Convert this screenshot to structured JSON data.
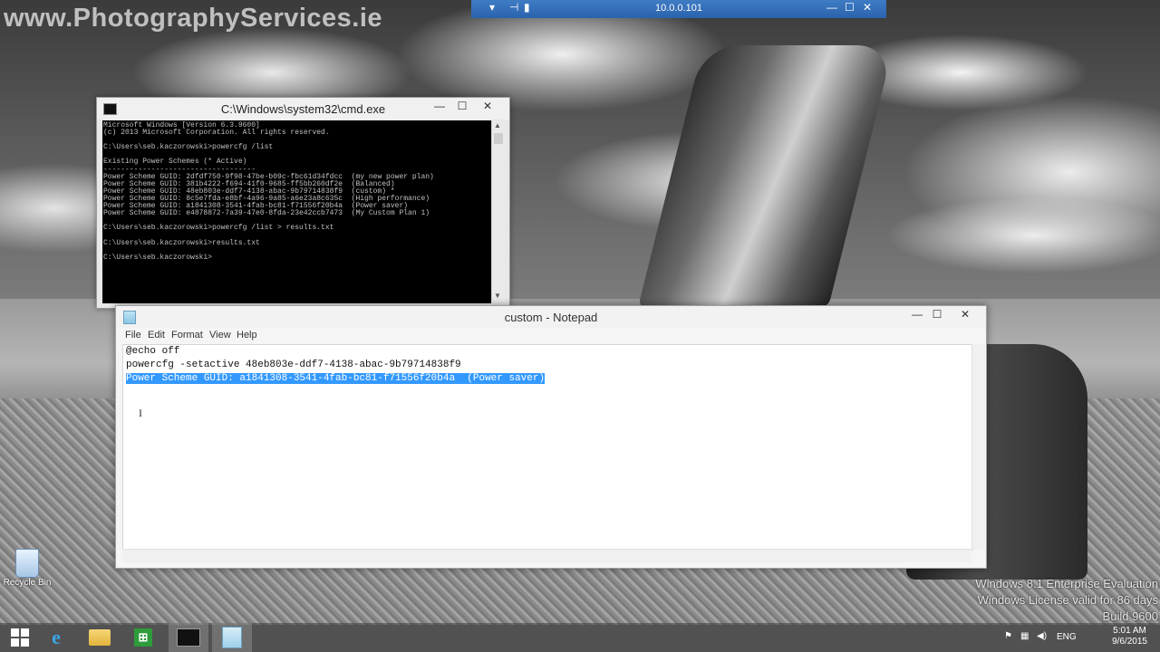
{
  "watermark": "www.PhotographyServices.ie",
  "remote_bar": {
    "host": "10.0.0.101"
  },
  "cmd": {
    "title": "C:\\Windows\\system32\\cmd.exe",
    "lines": [
      "Microsoft Windows [Version 6.3.9600]",
      "(c) 2013 Microsoft Corporation. All rights reserved.",
      "",
      "C:\\Users\\seb.kaczorowski>powercfg /list",
      "",
      "Existing Power Schemes (* Active)",
      "-----------------------------------",
      "Power Scheme GUID: 2dfdf750-9f98-47be-b09c-fbc61d34fdcc  (my new power plan)",
      "Power Scheme GUID: 381b4222-f694-41f0-9685-ff5bb260df2e  (Balanced)",
      "Power Scheme GUID: 48eb803e-ddf7-4138-abac-9b79714838f9  (custom) *",
      "Power Scheme GUID: 8c5e7fda-e8bf-4a96-9a85-a6e23a8c635c  (High performance)",
      "Power Scheme GUID: a1841308-3541-4fab-bc81-f71556f20b4a  (Power saver)",
      "Power Scheme GUID: e4878872-7a39-47e0-8fda-23e42ccb7473  (My Custom Plan 1)",
      "",
      "C:\\Users\\seb.kaczorowski>powercfg /list > results.txt",
      "",
      "C:\\Users\\seb.kaczorowski>results.txt",
      "",
      "C:\\Users\\seb.kaczorowski>"
    ]
  },
  "notepad": {
    "title": "custom - Notepad",
    "menu": [
      "File",
      "Edit",
      "Format",
      "View",
      "Help"
    ],
    "lines": [
      "@echo off",
      "powercfg -setactive 48eb803e-ddf7-4138-abac-9b79714838f9"
    ],
    "selected_line": "Power Scheme GUID: a1841308-3541-4fab-bc81-f71556f20b4a  (Power saver)"
  },
  "desktop": {
    "recycle_bin": "Recycle Bin",
    "windows_watermark": [
      "Windows 8.1 Enterprise Evaluation",
      "Windows License valid for 86 days",
      "Build 9600"
    ]
  },
  "taskbar": {
    "language": "ENG",
    "time": "5:01 AM",
    "date": "9/6/2015"
  },
  "window_controls": {
    "minimize": "—",
    "maximize": "☐",
    "close": "✕"
  }
}
